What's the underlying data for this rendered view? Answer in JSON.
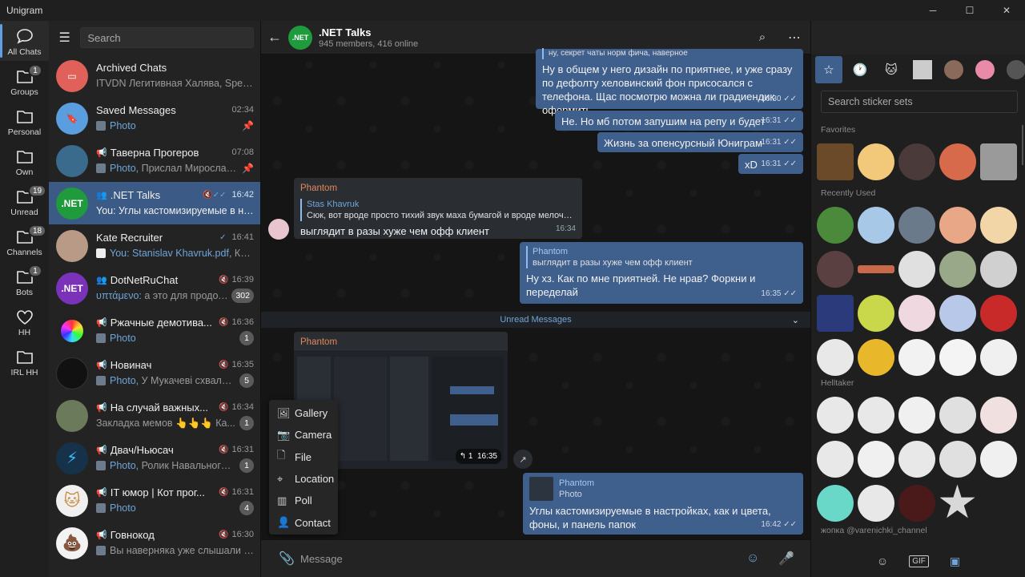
{
  "app": {
    "title": "Unigram"
  },
  "window": {
    "minimize": "─",
    "maximize": "☐",
    "close": "✕"
  },
  "folders": [
    {
      "label": "All Chats",
      "badge": "",
      "icon": "chat-bubbles-icon"
    },
    {
      "label": "Groups",
      "badge": "1",
      "icon": "folder-icon"
    },
    {
      "label": "Personal",
      "badge": "",
      "icon": "folder-icon"
    },
    {
      "label": "Own",
      "badge": "",
      "icon": "folder-icon"
    },
    {
      "label": "Unread",
      "badge": "19",
      "icon": "folder-icon"
    },
    {
      "label": "Channels",
      "badge": "18",
      "icon": "folder-icon"
    },
    {
      "label": "Bots",
      "badge": "1",
      "icon": "folder-icon"
    },
    {
      "label": "HH",
      "badge": "",
      "icon": "heart-icon"
    },
    {
      "label": "IRL HH",
      "badge": "",
      "icon": "folder-icon"
    }
  ],
  "search": {
    "placeholder": "Search"
  },
  "chats": [
    {
      "name": "Archived Chats",
      "time": "",
      "preview": "ITVDN Легитивная Халява, Speed-r...",
      "badge": "",
      "pinned": false,
      "avatar_color": "#e0605a",
      "avatar_text": "",
      "icon": "archive-icon"
    },
    {
      "name": "Saved Messages",
      "time": "02:34",
      "preview_hl": "Photo",
      "preview": "",
      "badge": "",
      "pinned": true,
      "avatar_color": "#5b9ee0",
      "avatar_text": "",
      "icon": "bookmark-icon"
    },
    {
      "name": "Таверна Прогеров",
      "time": "07:08",
      "preview_hl": "Photo,",
      "preview": " Прислал Мирослав...",
      "badge": "",
      "pinned": true,
      "avatar_color": "#3a6a8c",
      "avatar_text": "",
      "icon": "megaphone-icon"
    },
    {
      "name": ".NET Talks",
      "time": "16:42",
      "preview": "You: Углы кастомизируемые в наст...",
      "badge": "",
      "pinned": false,
      "avatar_color": "#1f9a3c",
      "avatar_text": ".NET",
      "icon": "group-icon",
      "active": true
    },
    {
      "name": "Kate Recruiter",
      "time": "16:41",
      "preview_hl": "You: Stanislav Khavruk.pdf,",
      "preview": " Крат...",
      "badge": "",
      "pinned": false,
      "avatar_color": "#b89a86",
      "avatar_text": ""
    },
    {
      "name": "DotNetRuChat",
      "time": "16:39",
      "preview_hl": "υπτάμενο:",
      "preview": " а это для продолж...",
      "badge": "302",
      "pinned": false,
      "avatar_color": "#7a33b8",
      "avatar_text": ".NET"
    },
    {
      "name": "Ржачные демотива...",
      "time": "16:36",
      "preview_hl": "Photo",
      "preview": "",
      "badge": "1",
      "pinned": false,
      "avatar_color": "#222",
      "avatar_text": ""
    },
    {
      "name": "Новинач",
      "time": "16:35",
      "preview_hl": "Photo,",
      "preview": " У Мукачеві схвалил...",
      "badge": "5",
      "pinned": false,
      "avatar_color": "#111",
      "avatar_text": ""
    },
    {
      "name": "На случай важных...",
      "time": "16:34",
      "preview": "Закладка мемов 👆👆👆 Ка...",
      "badge": "1",
      "pinned": false,
      "avatar_color": "#6a7a5a",
      "avatar_text": ""
    },
    {
      "name": "Двач/Ньюсач",
      "time": "16:31",
      "preview_hl": "Photo,",
      "preview": " Ролик Навального п...",
      "badge": "1",
      "pinned": false,
      "avatar_color": "#16324a",
      "avatar_text": ""
    },
    {
      "name": "IT юмор | Кот прог...",
      "time": "16:31",
      "preview_hl": "Photo",
      "preview": "",
      "badge": "4",
      "pinned": false,
      "avatar_color": "#f0f0f0",
      "avatar_text": ""
    },
    {
      "name": "Говнокод",
      "time": "16:30",
      "preview": "Вы наверняка уже слышали пр...",
      "badge": "",
      "pinned": false,
      "avatar_color": "#f3f3f3",
      "avatar_text": ""
    }
  ],
  "chat": {
    "title": ".NET Talks",
    "subtitle": "945 members, 416 online",
    "avatar_text": ".NET",
    "messages": [
      {
        "reply_snip": "ну, секрет чаты норм фича, наверное",
        "text": "Ну в общем у него дизайн по приятнее, и уже сразу по дефолту хеловинский фон присосался с телефона. Щас посмотрю можна ли градиендик оформить",
        "time": "16:30"
      },
      {
        "text": "Не. Но мб потом запушим на репу и будет",
        "time": "16:31"
      },
      {
        "text": "Жизнь за опенсурсный Юниграм",
        "time": "16:31"
      },
      {
        "text": "xD",
        "time": "16:31"
      },
      {
        "sender": "Phantom",
        "reply_name": "Stas Khavruk",
        "reply_text": "Сюк, вот вроде просто тихий звук маха бумагой и вроде мелочь, но та...",
        "text": "выглядит в разы хуже чем офф клиент",
        "time": "16:34"
      },
      {
        "reply_name": "Phantom",
        "reply_text": "выглядит в разы хуже чем офф клиент",
        "text": "Ну хз. Как по мне приятней. Не нрав? Форкни и переделай",
        "time": "16:35"
      },
      {
        "sender": "Phantom",
        "reactions": "↰ 1",
        "time": "16:35"
      },
      {
        "reply_name": "Phantom",
        "reply_text": "Photo",
        "text": "Углы кастомизируемые в настройках, как и цвета, фоны, и панель папок",
        "time": "16:42"
      }
    ],
    "unread_label": "Unread Messages",
    "composer_placeholder": "Message"
  },
  "attach_menu": [
    {
      "label": "Gallery",
      "icon": "image-icon"
    },
    {
      "label": "Camera",
      "icon": "camera-icon"
    },
    {
      "label": "File",
      "icon": "file-icon"
    },
    {
      "label": "Location",
      "icon": "location-pin-icon"
    },
    {
      "label": "Poll",
      "icon": "poll-icon"
    },
    {
      "label": "Contact",
      "icon": "contact-icon"
    }
  ],
  "stickers": {
    "search_placeholder": "Search sticker sets",
    "sections": [
      "Favorites",
      "Recently Used",
      "Helltaker"
    ],
    "footer_label": "жопка @varenichki_channel",
    "bottom_tabs": [
      "emoji",
      "GIF",
      "stickers"
    ]
  },
  "colors": {
    "accent": "#3f5f8d",
    "link": "#6fa5d8",
    "sender": "#e1885a"
  }
}
